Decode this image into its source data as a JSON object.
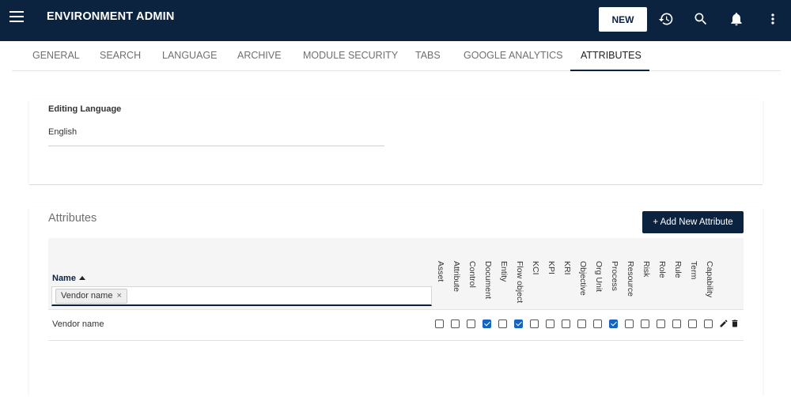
{
  "app": {
    "title": "ENVIRONMENT ADMIN",
    "new_label": "NEW"
  },
  "toolbar_icons": [
    "menu-icon",
    "history-icon",
    "search-icon",
    "bell-icon",
    "more-vert-icon"
  ],
  "tabs": [
    {
      "label": "GENERAL"
    },
    {
      "label": "SEARCH"
    },
    {
      "label": "LANGUAGE"
    },
    {
      "label": "ARCHIVE"
    },
    {
      "label": "MODULE SECURITY"
    },
    {
      "label": "TABS"
    },
    {
      "label": "GOOGLE ANALYTICS"
    },
    {
      "label": "ATTRIBUTES",
      "active": true
    }
  ],
  "editing_language": {
    "label": "Editing Language",
    "value": "English"
  },
  "attributes": {
    "title": "Attributes",
    "add_label": "+ Add New Attribute",
    "name_header": "Name",
    "filter_chip": "Vendor name",
    "columns": [
      "Asset",
      "Attribute",
      "Control",
      "Document",
      "Entity",
      "Flow object",
      "KCI",
      "KPI",
      "KRI",
      "Objective",
      "Org Unit",
      "Process",
      "Resource",
      "Risk",
      "Role",
      "Rule",
      "Term",
      "Capability"
    ],
    "rows": [
      {
        "name": "Vendor name",
        "checks": [
          false,
          false,
          false,
          true,
          false,
          true,
          false,
          false,
          false,
          false,
          false,
          true,
          false,
          false,
          false,
          false,
          false,
          false
        ]
      }
    ]
  },
  "colors": {
    "appbar": "#0c2340",
    "accent": "#1565c0"
  }
}
